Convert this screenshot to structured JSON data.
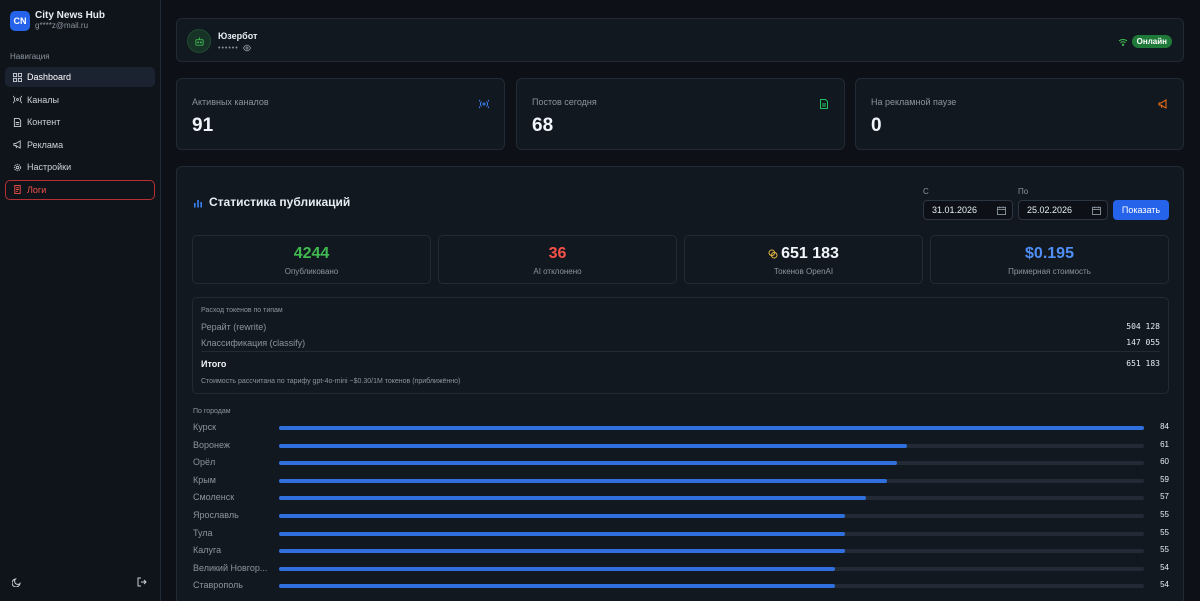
{
  "brand": {
    "logo": "CN",
    "name": "City News Hub",
    "email": "g****z@mail.ru"
  },
  "sidebar": {
    "heading": "Навигация",
    "items": [
      {
        "label": "Dashboard",
        "icon": "grid-icon",
        "active": true
      },
      {
        "label": "Каналы",
        "icon": "broadcast-icon"
      },
      {
        "label": "Контент",
        "icon": "document-icon"
      },
      {
        "label": "Реклама",
        "icon": "megaphone-icon"
      },
      {
        "label": "Настройки",
        "icon": "gear-icon"
      },
      {
        "label": "Логи",
        "icon": "log-icon",
        "danger": true
      }
    ],
    "bottom_icons": [
      "moon-icon",
      "logout-icon"
    ]
  },
  "bot": {
    "name": "Юзербот",
    "masked": "••••••",
    "status": "Онлайн"
  },
  "stats": [
    {
      "label": "Активных каналов",
      "value": "91",
      "icon": "broadcast-icon",
      "color": "#3b82f6"
    },
    {
      "label": "Постов сегодня",
      "value": "68",
      "icon": "document-icon",
      "color": "#22c55e"
    },
    {
      "label": "На рекламной паузе",
      "value": "0",
      "icon": "megaphone-icon",
      "color": "#f97316"
    }
  ],
  "publications": {
    "title": "Статистика публикаций",
    "from_label": "С",
    "to_label": "По",
    "from_date": "31.01.2026",
    "to_date": "25.02.2026",
    "show_button": "Показать",
    "metrics": [
      {
        "value": "4244",
        "label": "Опубликовано",
        "color": "#3fb950"
      },
      {
        "value": "36",
        "label": "AI отклонено",
        "color": "#f85149"
      },
      {
        "value": "651 183",
        "label": "Токенов OpenAI",
        "color": "#f0f6fc"
      },
      {
        "value": "$0.195",
        "label": "Примерная стоимость",
        "color": "#4f8ff7"
      }
    ],
    "tokens": {
      "title": "Расход токенов по типам",
      "rows": [
        {
          "label": "Рерайт (rewrite)",
          "value": "504 128"
        },
        {
          "label": "Классификация (classify)",
          "value": "147 055"
        }
      ],
      "total_label": "Итого",
      "total_value": "651 183",
      "note": "Стоимость рассчитана по тарифу gpt-4o-mini ~$0.30/1M токенов (приближённо)"
    },
    "cities_title": "По городам",
    "cities_max": 84,
    "cities": [
      {
        "name": "Курск",
        "count": 84
      },
      {
        "name": "Воронеж",
        "count": 61
      },
      {
        "name": "Орёл",
        "count": 60
      },
      {
        "name": "Крым",
        "count": 59
      },
      {
        "name": "Смоленск",
        "count": 57
      },
      {
        "name": "Ярославль",
        "count": 55
      },
      {
        "name": "Тула",
        "count": 55
      },
      {
        "name": "Калуга",
        "count": 55
      },
      {
        "name": "Великий Новгор...",
        "count": 54
      },
      {
        "name": "Ставрополь",
        "count": 54
      }
    ]
  }
}
